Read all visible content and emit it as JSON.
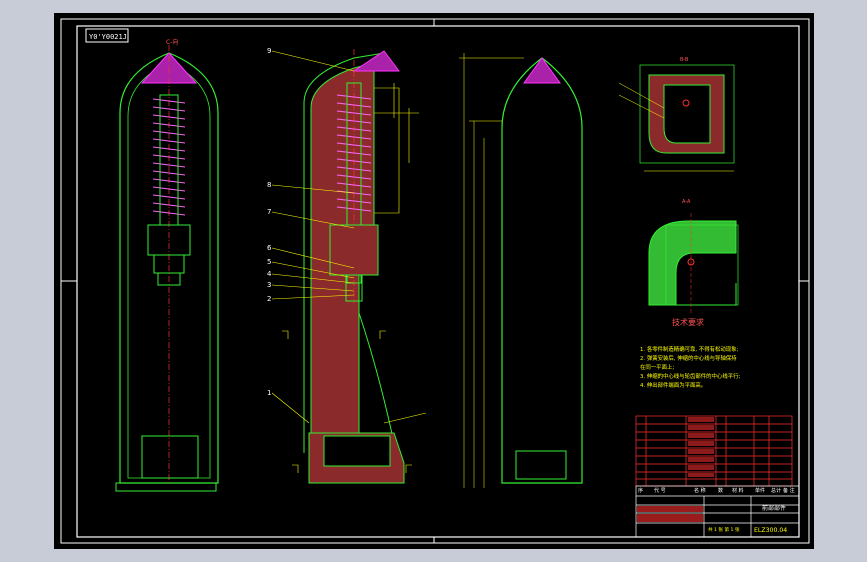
{
  "colors": {
    "background": "#000000",
    "frame": "#ffffff",
    "outline": "#33ee33",
    "hatch": "#c83232",
    "dimension": "#ffff00",
    "centerline": "#ff3030",
    "cap": "#ff33ff",
    "spring": "#ff66ff",
    "table": "#ff3030"
  },
  "sheet": {
    "corner_tag": "Y0'Y0021J",
    "drawing_no": "ELZ300.04"
  },
  "views": {
    "view_a_label": "C-向",
    "section_b_label": "B-B",
    "section_c_label": "A-A",
    "tech_title": "技术要求"
  },
  "leaders": [
    "9",
    "8",
    "7",
    "6",
    "5",
    "4",
    "3",
    "2",
    "1"
  ],
  "notes": [
    "1. 各零件制造精确可靠, 不得有松动现象;",
    "2. 弹簧安装后, 伸缩的中心线与导轴保持",
    "   在同一平面上;",
    "3. 伸缩的中心线与轮齿部件的中心线平行;",
    "4. 伸出部件端面为平面高。"
  ],
  "titleblock": {
    "part_name": "前部部件",
    "sheet_label": "共 1 张  第 1 张",
    "header_cols": [
      "序",
      "代 号",
      "名 称",
      "数",
      "材 料",
      "单件",
      "总计",
      "备 注"
    ]
  }
}
